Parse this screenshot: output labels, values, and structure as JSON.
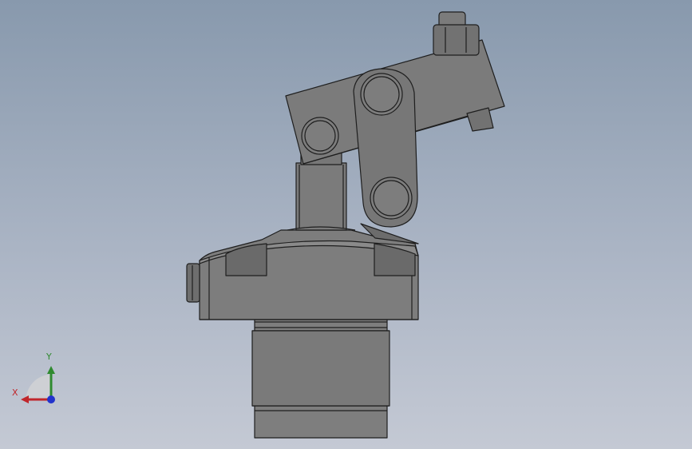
{
  "viewport": {
    "background_top": "#8899ad",
    "background_bottom": "#c4c9d4"
  },
  "model": {
    "name": "swing-clamp-cylinder",
    "body_color": "#7b7b7b",
    "shadow_color": "#666666",
    "edge_color": "#1e1e1e"
  },
  "triad": {
    "x_label": "X",
    "y_label": "Y",
    "x_color": "#c0262b",
    "y_color": "#2f8a2f",
    "z_color": "#2233cc"
  }
}
